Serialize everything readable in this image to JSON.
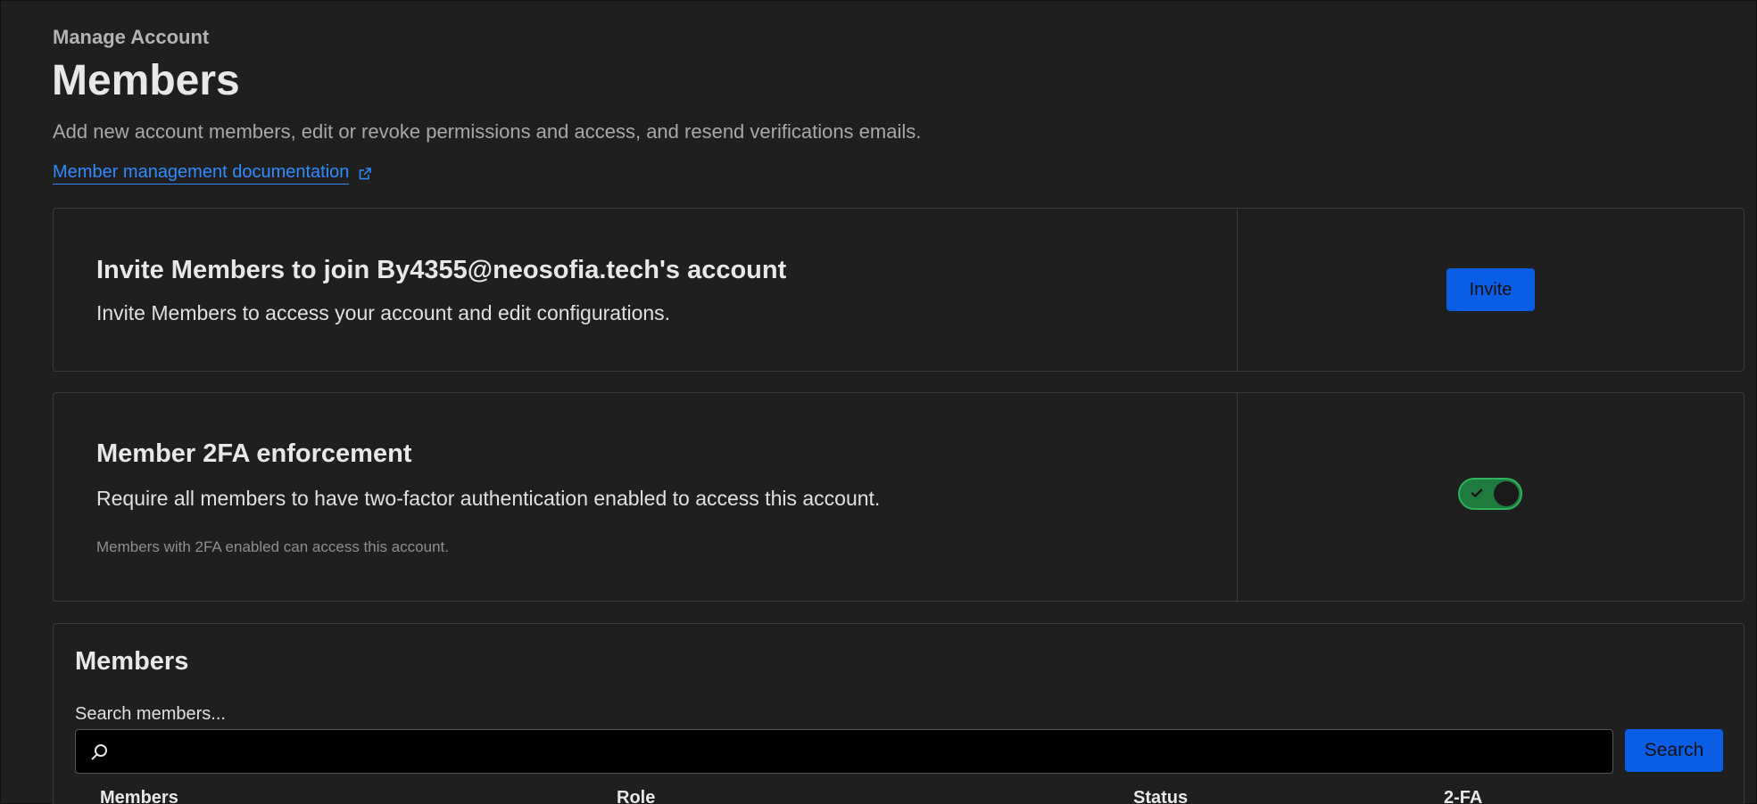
{
  "header": {
    "breadcrumb": "Manage Account",
    "title": "Members",
    "description": "Add new account members, edit or revoke permissions and access, and resend verifications emails.",
    "doc_link_label": "Member management documentation",
    "doc_link_icon": "external-link-icon"
  },
  "invite_card": {
    "title": "Invite Members to join By4355@neosofia.tech's account",
    "description": "Invite Members to access your account and edit configurations.",
    "button_label": "Invite"
  },
  "tfa_card": {
    "title": "Member 2FA enforcement",
    "description": "Require all members to have two-factor authentication enabled to access this account.",
    "note": "Members with 2FA enabled can access this account.",
    "toggle_on": true,
    "toggle_icon": "check-icon"
  },
  "members_section": {
    "title": "Members",
    "search_label": "Search members...",
    "search_value": "",
    "search_icon": "search-icon",
    "search_button_label": "Search",
    "columns": [
      "Members",
      "Role",
      "Status",
      "2-FA"
    ]
  },
  "colors": {
    "background": "#1f1f1f",
    "accent": "#0a5ee6",
    "link": "#2f8bff",
    "toggle_on": "#1f7a3d"
  }
}
